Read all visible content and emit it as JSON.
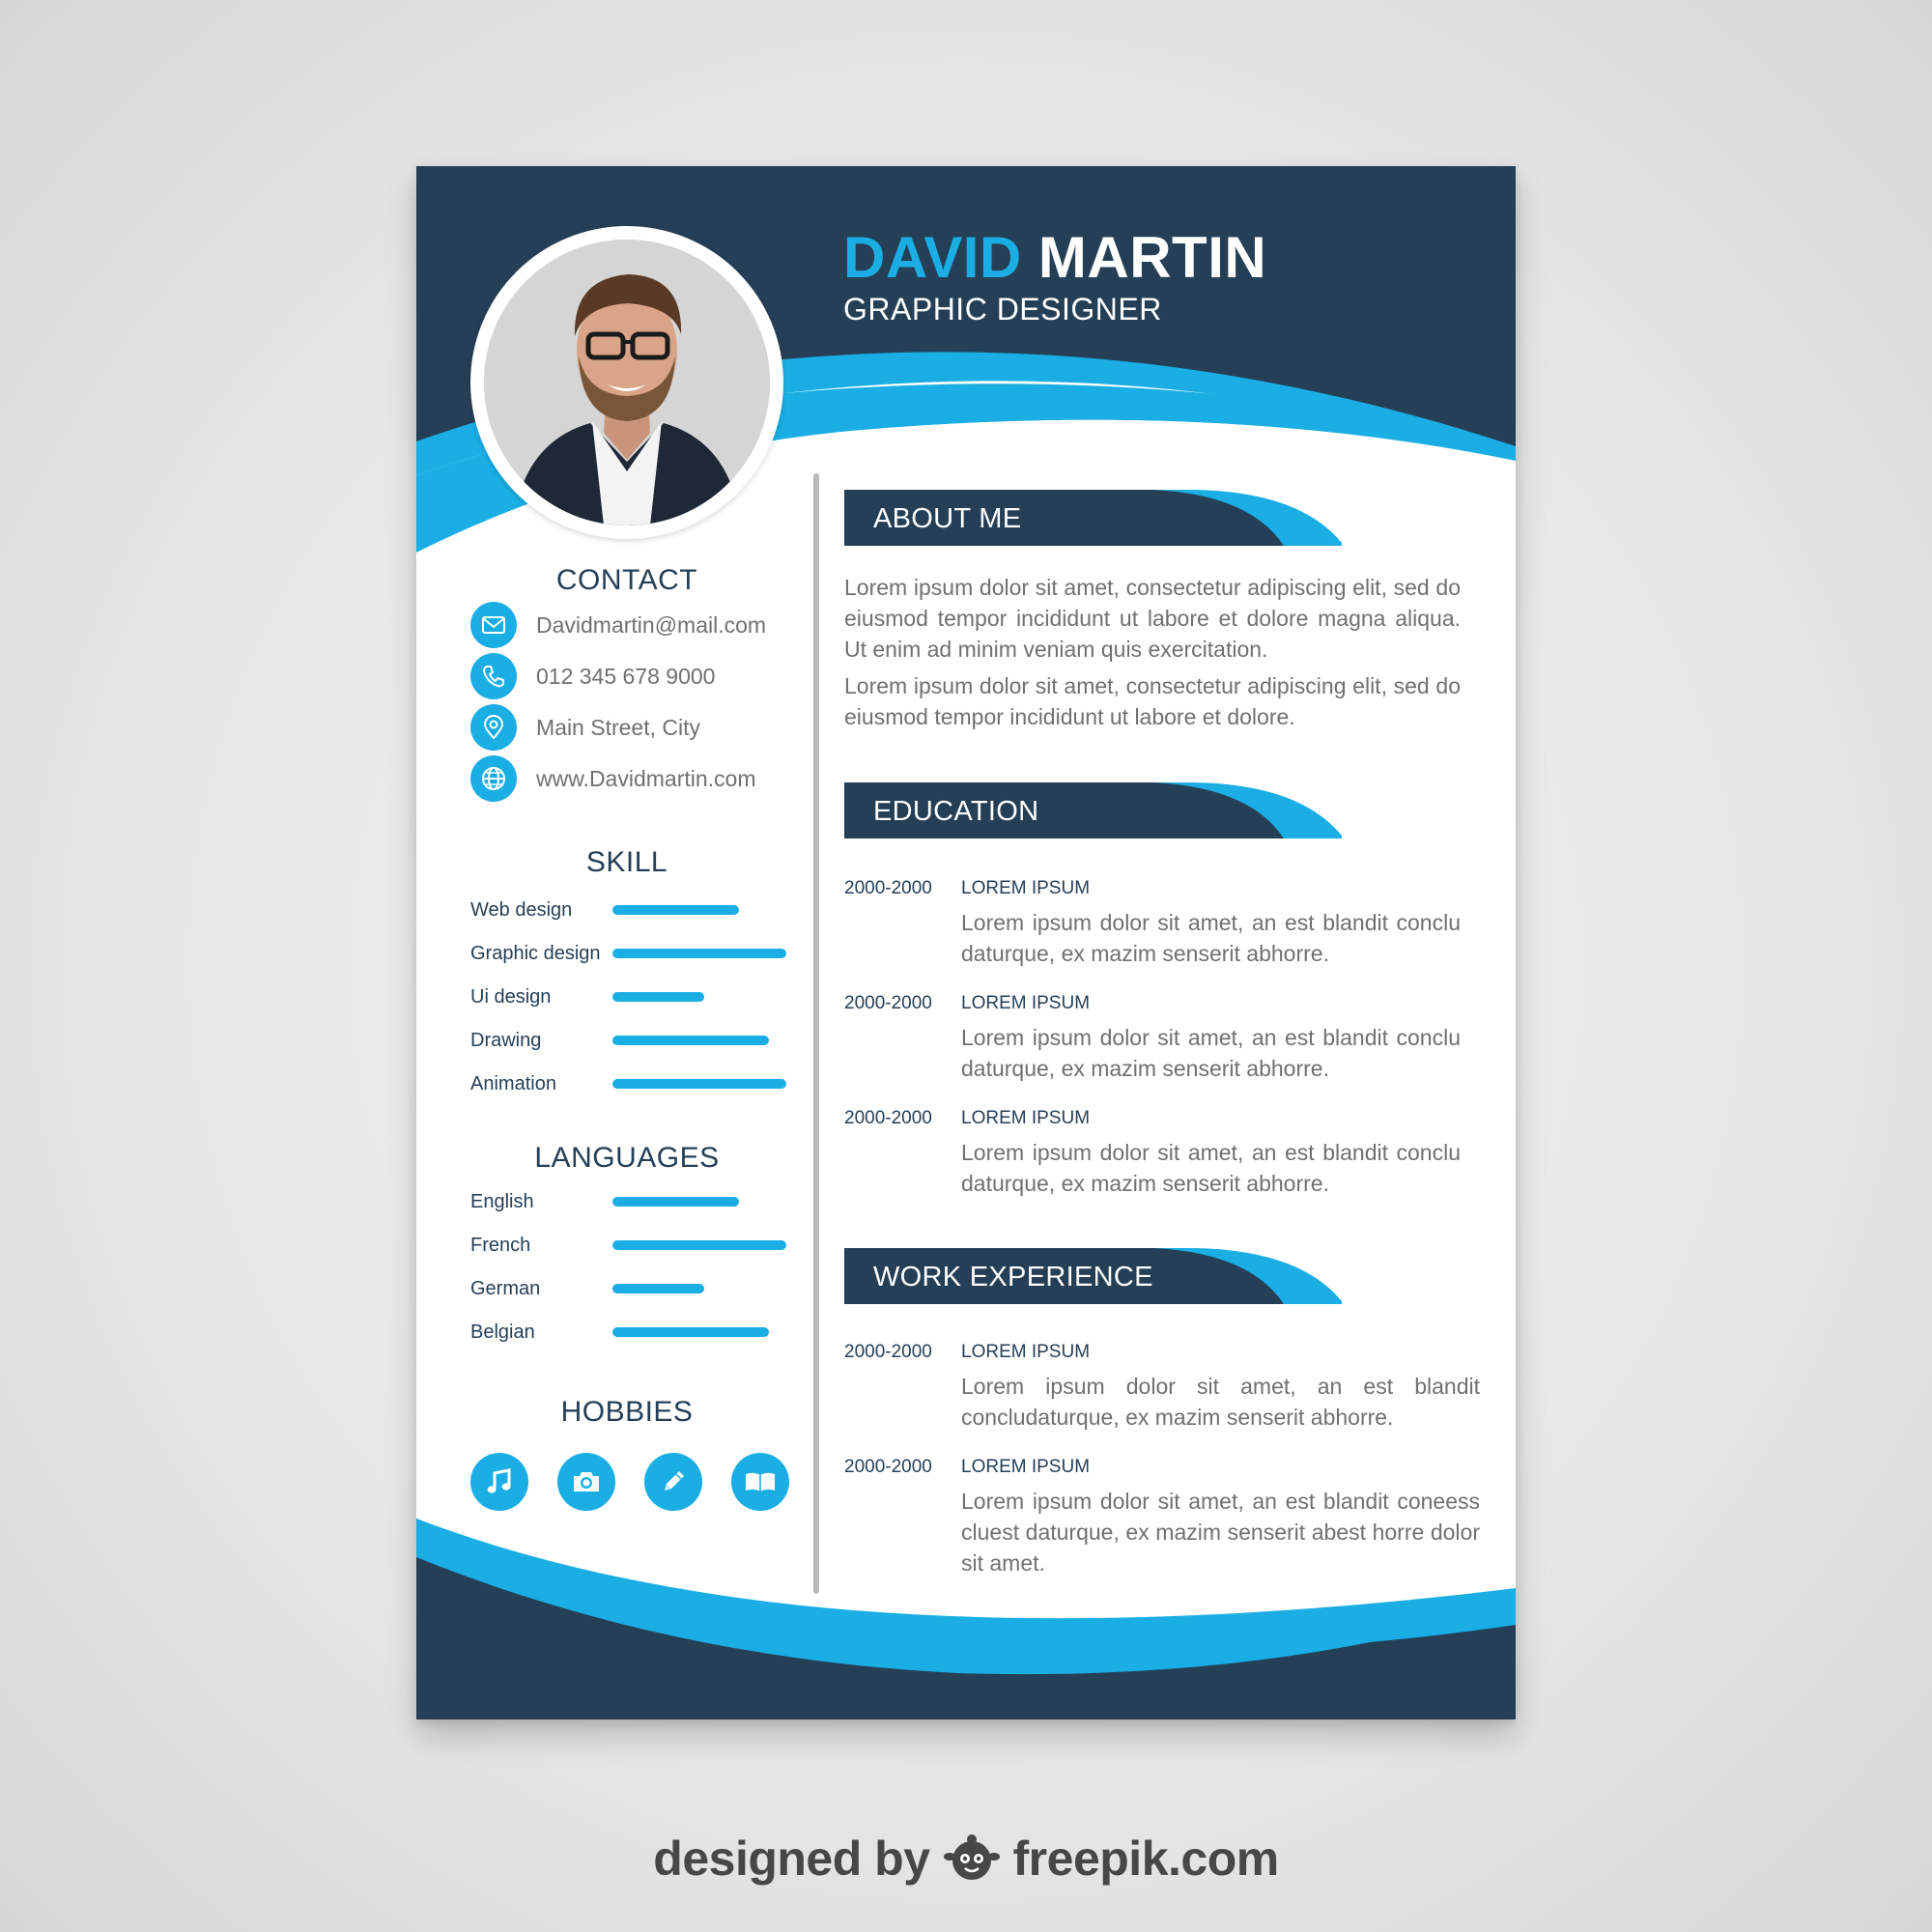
{
  "colors": {
    "navy": "#253f57",
    "accent": "#1aaee4",
    "text_gray": "#707070",
    "white": "#ffffff"
  },
  "header": {
    "first_name": "DAVID",
    "last_name": "MARTIN",
    "title": "GRAPHIC DESIGNER"
  },
  "contact": {
    "heading": "CONTACT",
    "items": [
      {
        "icon": "envelope-icon",
        "text": "Davidmartin@mail.com"
      },
      {
        "icon": "phone-icon",
        "text": "012 345 678 9000"
      },
      {
        "icon": "location-pin-icon",
        "text": "Main Street, City"
      },
      {
        "icon": "globe-icon",
        "text": "www.Davidmartin.com"
      }
    ]
  },
  "skills": {
    "heading": "SKILL",
    "items": [
      {
        "label": "Web design",
        "level": 0.73
      },
      {
        "label": "Graphic design",
        "level": 1.0
      },
      {
        "label": "Ui design",
        "level": 0.53
      },
      {
        "label": "Drawing",
        "level": 0.9
      },
      {
        "label": "Animation",
        "level": 1.0
      }
    ]
  },
  "languages": {
    "heading": "LANGUAGES",
    "items": [
      {
        "label": "English",
        "level": 0.73
      },
      {
        "label": "French",
        "level": 1.0
      },
      {
        "label": "German",
        "level": 0.53
      },
      {
        "label": "Belgian",
        "level": 0.9
      }
    ]
  },
  "hobbies": {
    "heading": "HOBBIES",
    "items": [
      {
        "icon": "music-note-icon"
      },
      {
        "icon": "camera-icon"
      },
      {
        "icon": "pencil-icon"
      },
      {
        "icon": "book-icon"
      }
    ]
  },
  "about": {
    "heading": "ABOUT ME",
    "paragraphs": [
      "Lorem ipsum dolor sit amet, consectetur adipiscing elit, sed do eiusmod tempor incididunt ut labore et dolore magna aliqua. Ut enim ad minim veniam quis exercitation.",
      "Lorem ipsum dolor sit amet, consectetur adipiscing elit, sed do eiusmod tempor incididunt ut labore et dolore."
    ]
  },
  "education": {
    "heading": "EDUCATION",
    "entries": [
      {
        "date": "2000-2000",
        "title": "LOREM IPSUM",
        "text": "Lorem ipsum dolor sit amet, an est blandit conclu daturque, ex mazim senserit abhorre."
      },
      {
        "date": "2000-2000",
        "title": "LOREM IPSUM",
        "text": "Lorem ipsum dolor sit amet, an est blandit conclu daturque, ex mazim senserit abhorre."
      },
      {
        "date": "2000-2000",
        "title": "LOREM IPSUM",
        "text": "Lorem ipsum dolor sit amet, an est blandit conclu daturque, ex mazim senserit abhorre."
      }
    ]
  },
  "work": {
    "heading": "WORK EXPERIENCE",
    "entries": [
      {
        "date": "2000-2000",
        "title": "LOREM IPSUM",
        "text": "Lorem ipsum dolor sit amet, an est blandit concludaturque, ex mazim senserit abhorre."
      },
      {
        "date": "2000-2000",
        "title": "LOREM IPSUM",
        "text": "Lorem ipsum dolor sit amet, an est blandit coneess cluest daturque, ex mazim senserit abest horre dolor sit amet."
      }
    ]
  },
  "credit": {
    "prefix": "designed by",
    "brand": "freepik.com",
    "logo_icon": "freepik-logo-icon"
  }
}
